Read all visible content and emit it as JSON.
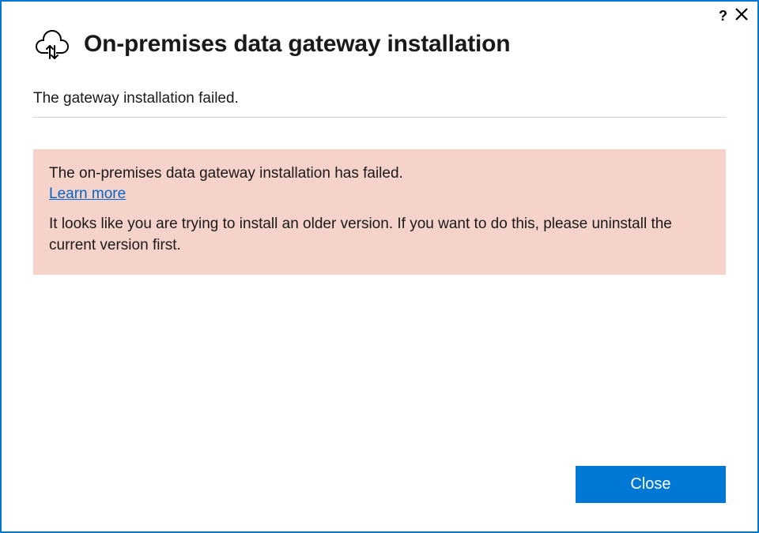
{
  "header": {
    "title": "On-premises data gateway installation"
  },
  "status": {
    "message": "The gateway installation failed."
  },
  "error_panel": {
    "title": "The on-premises data gateway installation has failed.",
    "learn_more_label": "Learn more",
    "detail": "It looks like you are trying to install an older version. If you want to do this, please uninstall the current version first."
  },
  "footer": {
    "close_label": "Close"
  },
  "titlebar": {
    "help_glyph": "?"
  },
  "colors": {
    "accent": "#0078d4",
    "error_bg": "#f6d3ca",
    "link": "#0066cc"
  }
}
